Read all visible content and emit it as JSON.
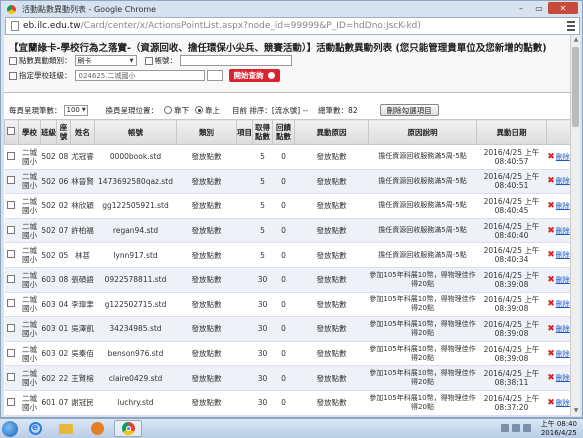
{
  "window": {
    "title": "活動點數異動列表 - Google Chrome"
  },
  "address": {
    "host": "eb.ilc.edu.tw",
    "path": "/Card/center/x/ActionsPointList.aspx?node_id=99999&P_ID=hdDno:JscK-kd)"
  },
  "heading": "【宜蘭綠卡-學校行為之落實-（資源回收、擔任環保小尖兵、競賽活動）】活動點數異動列表 (您只能管理貴單位及您新增的點數)",
  "filters": {
    "type_label": "點數異動類別：",
    "type_value": "刷卡",
    "account_label": "帳號：",
    "account_value": "",
    "school_label": "指定學校班級：",
    "school_value": "024625.二城國小",
    "search_button": "開始查詢"
  },
  "list_controls": {
    "page_size_label": "每頁呈現筆數：",
    "page_size_value": "100",
    "order_label": "換頁呈現位置：",
    "order_down": "靠下",
    "order_up": "靠上",
    "current_sort": "目前 排序：[流水號] -- ",
    "total": "總筆數：82",
    "delete_button": "刪除勾選項目"
  },
  "table": {
    "headers": [
      "",
      "學校",
      "班級",
      "座號",
      "姓名",
      "帳號",
      "類別",
      "項目",
      "取得點數",
      "回饋點數",
      "異動原因",
      "原因說明",
      "異動日期",
      ""
    ],
    "rows": [
      [
        "二城國小",
        "502",
        "08",
        "尤冠睿",
        "0000book.std",
        "發放點數",
        "",
        "5",
        "0",
        "發放點數",
        "擔任資源回收服務滿5周-5點",
        "2016/4/25 上午08:40:57",
        "刪除"
      ],
      [
        "二城國小",
        "502",
        "06",
        "林晉賢",
        "1473692580qaz.std",
        "發放點數",
        "",
        "5",
        "0",
        "發放點數",
        "擔任資源回收服務滿5周-5點",
        "2016/4/25 上午08:40:51",
        "刪除"
      ],
      [
        "二城國小",
        "502",
        "02",
        "林欣穎",
        "gg122505921.std",
        "發放點數",
        "",
        "5",
        "0",
        "發放點數",
        "擔任資源回收服務滿5周-5點",
        "2016/4/25 上午08:40:45",
        "刪除"
      ],
      [
        "二城國小",
        "502",
        "07",
        "許柏福",
        "regan94.std",
        "發放點數",
        "",
        "5",
        "0",
        "發放點數",
        "擔任資源回收服務滿5周-5點",
        "2016/4/25 上午08:40:40",
        "刪除"
      ],
      [
        "二城國小",
        "502",
        "05",
        "林甚",
        "lynn917.std",
        "發放點數",
        "",
        "5",
        "0",
        "發放點數",
        "擔任資源回收服務滿5周-5點",
        "2016/4/25 上午08:40:34",
        "刪除"
      ],
      [
        "二城國小",
        "603",
        "08",
        "張碩語",
        "0922578811.std",
        "發放點數",
        "",
        "30",
        "0",
        "發放點數",
        "參加105年科展10幣，得物理佳作得20點",
        "2016/4/25 上午08:39:08",
        "刪除"
      ],
      [
        "二城國小",
        "603",
        "04",
        "李瑋聿",
        "g122502715.std",
        "發放點數",
        "",
        "30",
        "0",
        "發放點數",
        "參加105年科展10幣，得物理佳作得20點",
        "2016/4/25 上午08:39:08",
        "刪除"
      ],
      [
        "二城國小",
        "603",
        "01",
        "吳澤凱",
        "34234985.std",
        "發放點數",
        "",
        "30",
        "0",
        "發放點數",
        "參加105年科展10幣，得物理佳作得20點",
        "2016/4/25 上午08:39:08",
        "刪除"
      ],
      [
        "二城國小",
        "603",
        "02",
        "吳秦佰",
        "benson976.std",
        "發放點數",
        "",
        "30",
        "0",
        "發放點數",
        "參加105年科展10幣，得物理佳作得20點",
        "2016/4/25 上午08:39:08",
        "刪除"
      ],
      [
        "二城國小",
        "602",
        "22",
        "王賢榕",
        "claire0429.std",
        "發放點數",
        "",
        "30",
        "0",
        "發放點數",
        "參加105年科展10幣，得物理佳作得20點",
        "2016/4/25 上午08:38:11",
        "刪除"
      ],
      [
        "二城國小",
        "601",
        "07",
        "謝冠民",
        "luchry.std",
        "發放點數",
        "",
        "30",
        "0",
        "發放點數",
        "參加105年科展10幣，得物理佳作得20點",
        "2016/4/25 上午08:37:20",
        "刪除"
      ]
    ]
  },
  "taskbar": {
    "time": "上午 08:40",
    "date": "2016/4/25"
  },
  "colors": {
    "accent": "#d9232f",
    "link": "#1a57c6"
  }
}
